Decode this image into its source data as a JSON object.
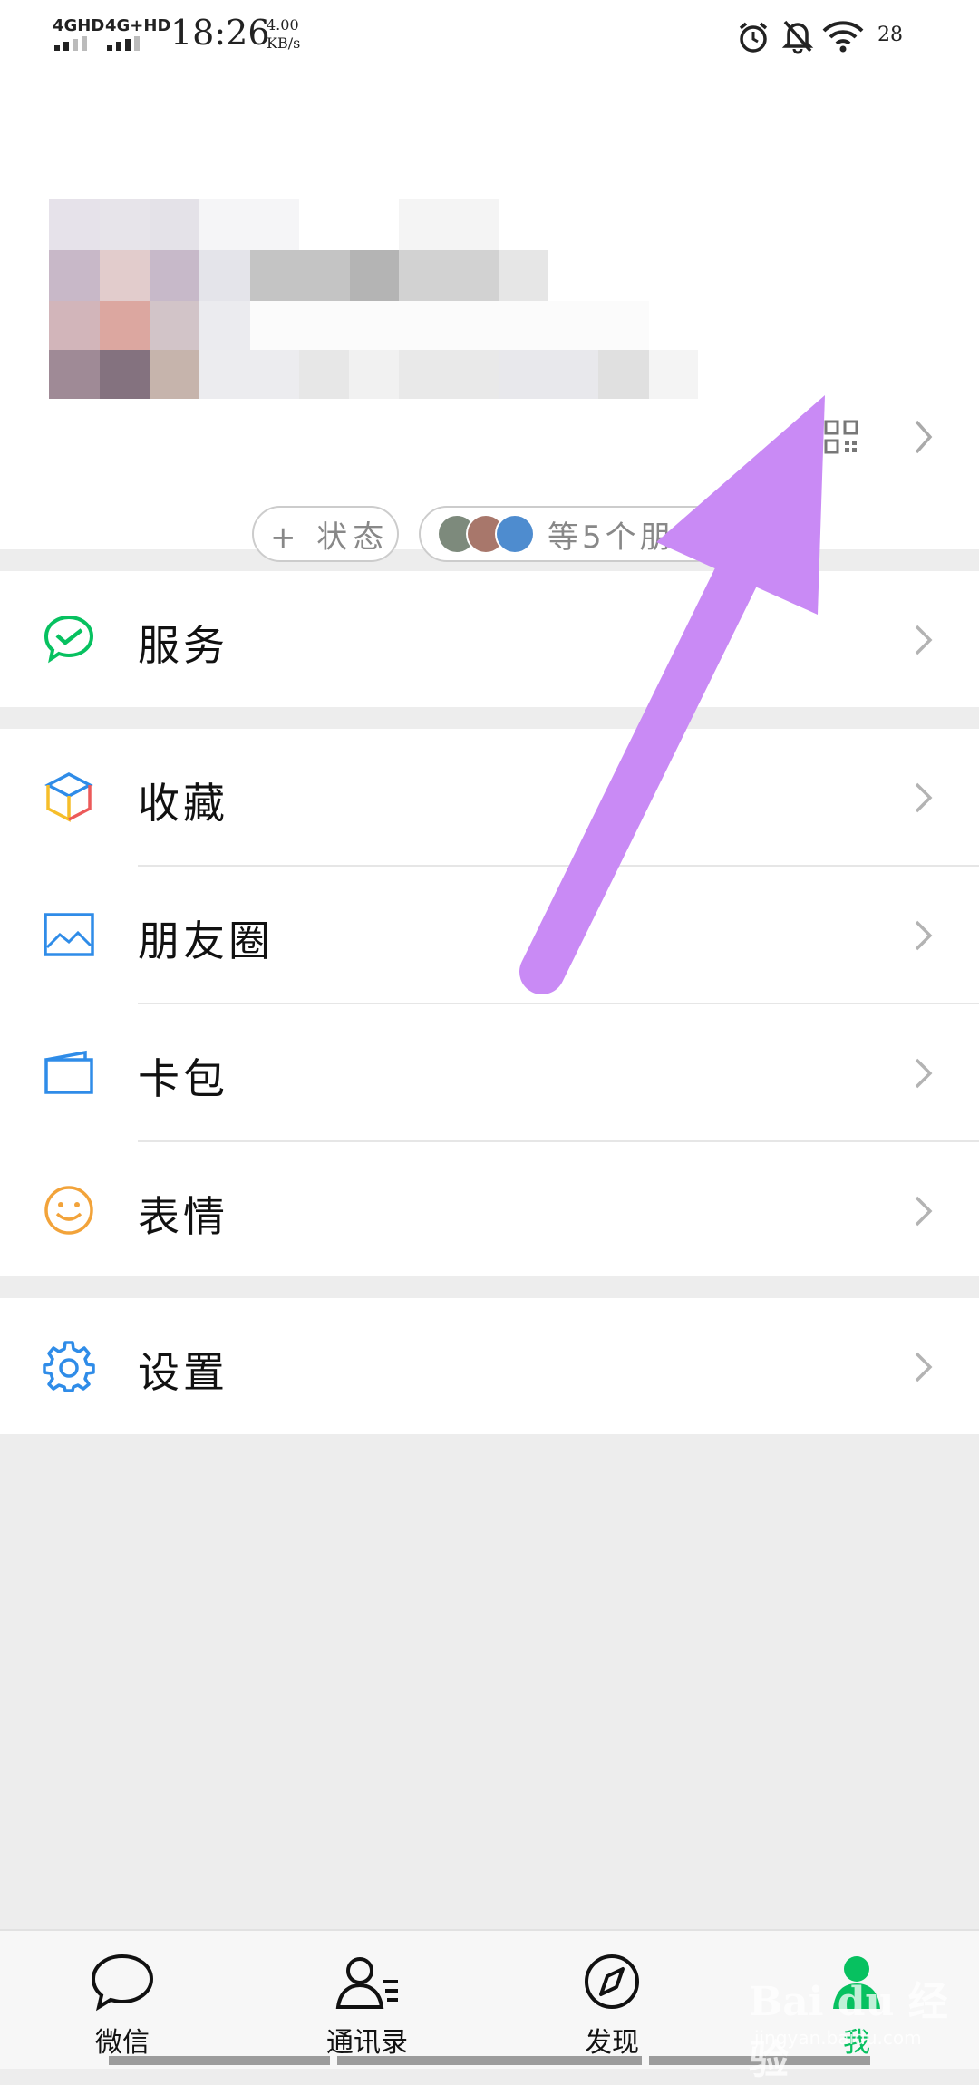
{
  "status_bar": {
    "network_1": "4GHD",
    "network_2": "4G+HD",
    "time": "18:26",
    "speed_value": "4.00",
    "speed_unit": "KB/s",
    "battery": "28"
  },
  "profile": {
    "status_button_label": "+ 状态",
    "friends_chip_label": "等5个朋友"
  },
  "menu": {
    "service": "服务",
    "favorites": "收藏",
    "moments": "朋友圈",
    "cards": "卡包",
    "stickers": "表情",
    "settings": "设置"
  },
  "tabbar": {
    "tabs": [
      {
        "label": "微信"
      },
      {
        "label": "通讯录"
      },
      {
        "label": "发现"
      },
      {
        "label": "我"
      }
    ]
  },
  "watermark": {
    "brand": "Bai du 经验",
    "url": "jingyan.baidu.com"
  },
  "colors": {
    "accent_green": "#07c160",
    "arrow": "#c98af5",
    "list_bg": "#ededed"
  }
}
